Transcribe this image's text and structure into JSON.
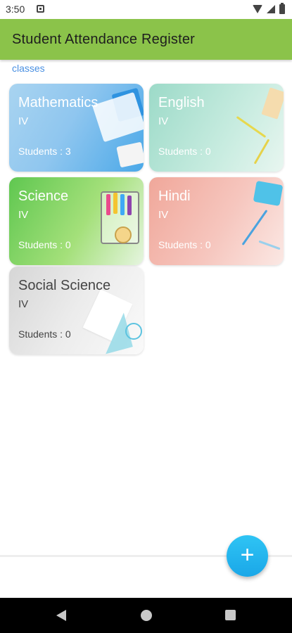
{
  "status_bar": {
    "time": "3:50"
  },
  "app_bar": {
    "title": "Student Attendance Register"
  },
  "section_label": "classes",
  "classes": [
    {
      "name": "Mathematics",
      "grade": "IV",
      "students": "Students : 3"
    },
    {
      "name": "English",
      "grade": "IV",
      "students": "Students : 0"
    },
    {
      "name": "Science",
      "grade": "IV",
      "students": "Students : 0"
    },
    {
      "name": "Hindi",
      "grade": "IV",
      "students": "Students : 0"
    },
    {
      "name": "Social Science",
      "grade": "IV",
      "students": "Students : 0"
    }
  ],
  "fab": {
    "icon": "+"
  },
  "colors": {
    "app_bar": "#8bc34a",
    "fab": "#29b6f6",
    "link": "#4a90e2"
  }
}
